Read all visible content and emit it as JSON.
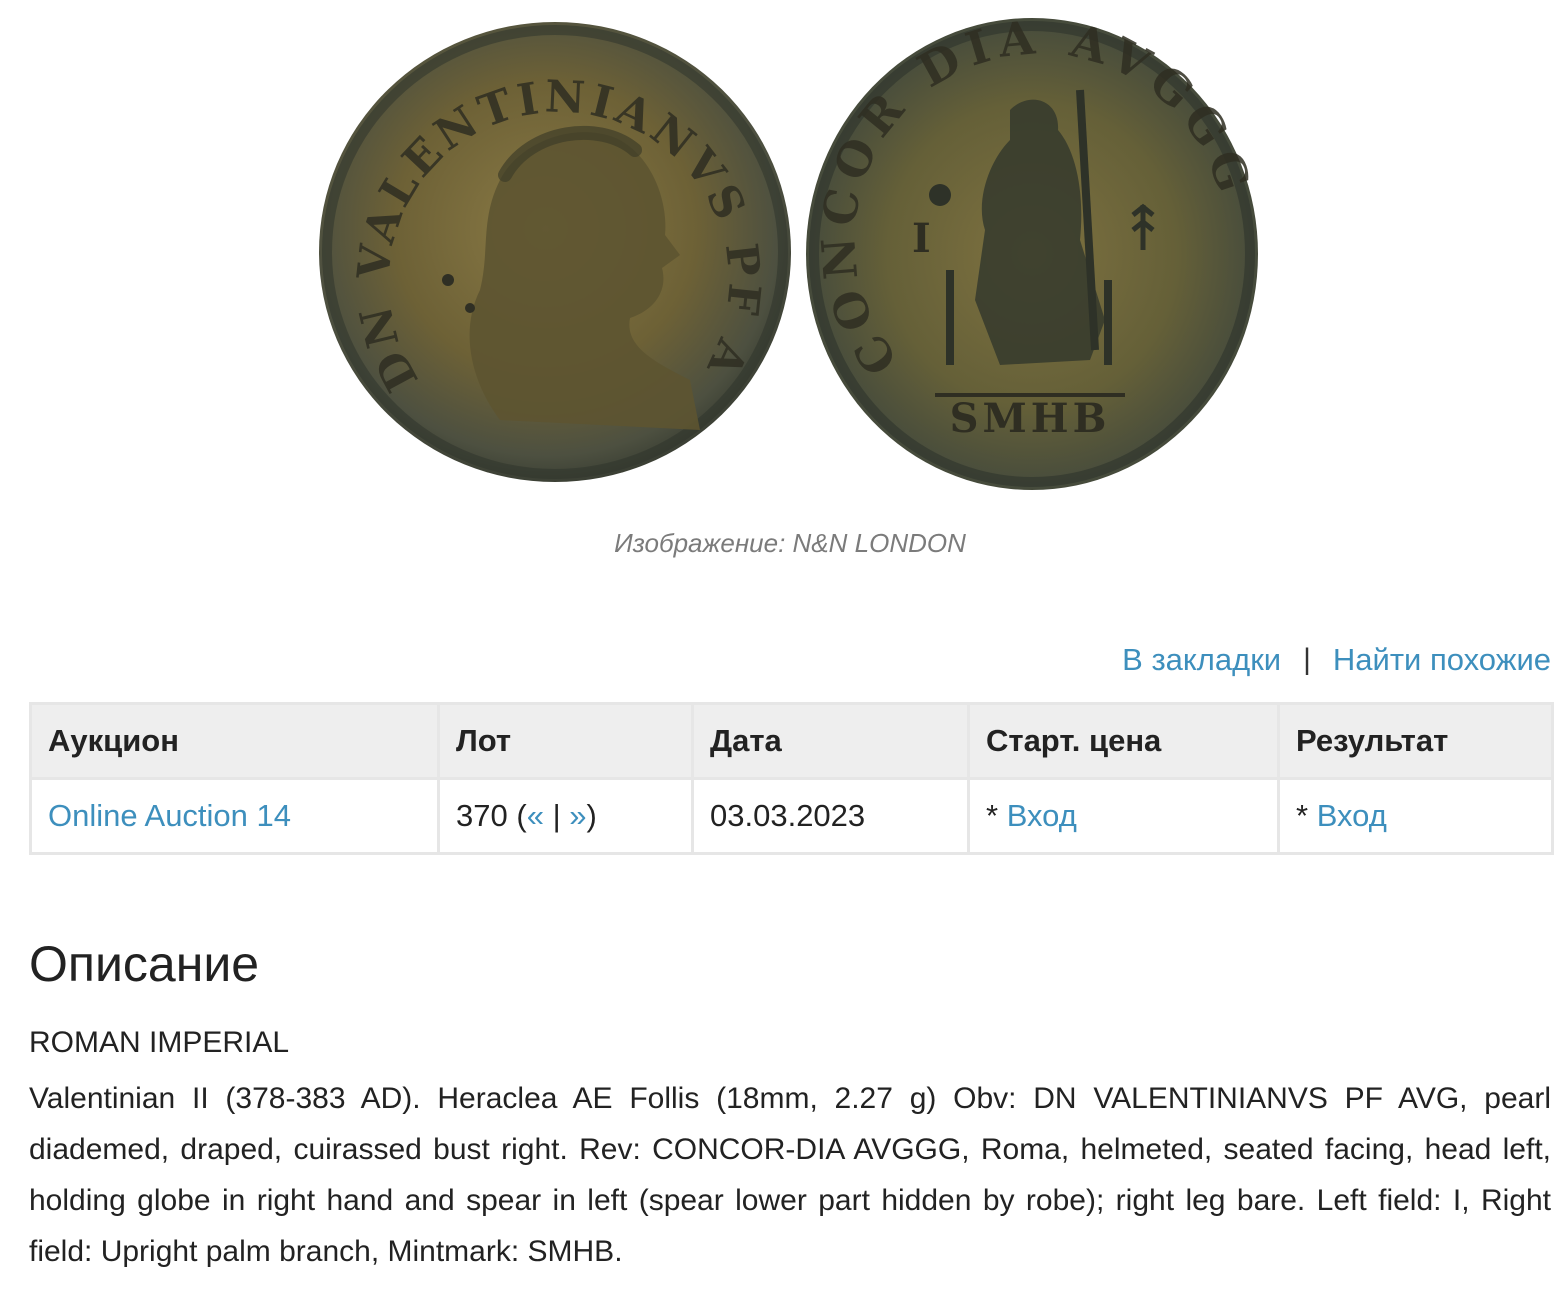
{
  "image": {
    "obverse_legend": "DN VALENTINIANVS PF AVG",
    "reverse_legend": "CONCOR DIA AVGGG",
    "reverse_field_left": "I",
    "mintmark": "SMHB",
    "caption": "Изображение: N&N LONDON"
  },
  "actions": {
    "bookmark": "В закладки",
    "separator": "|",
    "find_similar": "Найти похожие"
  },
  "table": {
    "headers": [
      "Аукцион",
      "Лот",
      "Дата",
      "Старт. цена",
      "Результат"
    ],
    "row": {
      "auction": "Online Auction 14",
      "lot_number": "370",
      "lot_open": "(",
      "prev": "«",
      "lot_sep": "|",
      "next": "»",
      "lot_close": ")",
      "date": "03.03.2023",
      "start_price_prefix": "*",
      "start_price_link": "Вход",
      "result_prefix": "*",
      "result_link": "Вход"
    }
  },
  "description": {
    "title": "Описание",
    "category": "ROMAN IMPERIAL",
    "text": "Valentinian II (378-383 AD). Heraclea AE Follis (18mm, 2.27 g) Obv: DN VALENTINIANVS PF AVG, pearl diademed, draped, cuirassed bust right. Rev: CONCOR-DIA AVGGG, Roma, helmeted, seated facing, head left, holding globe in right hand and spear in left (spear lower part hidden by robe); right leg bare. Left field: I, Right field: Upright palm branch, Mintmark: SMHB."
  },
  "colors": {
    "link": "#3d8fbd",
    "header_bg": "#eeeeee",
    "coin_bronze": "#7a6a3a",
    "coin_patina": "#3f463c"
  }
}
